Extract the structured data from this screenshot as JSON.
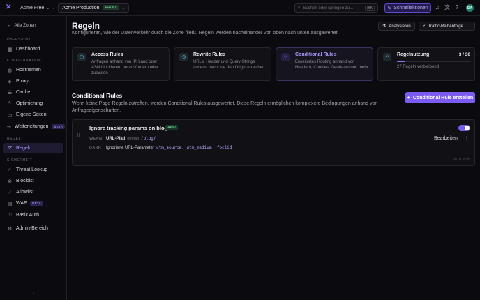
{
  "topbar": {
    "org": "Acme Free",
    "zone": "Acme Production",
    "zone_badge": "PROD",
    "search_placeholder": "Suchen oder springen zu...",
    "search_shortcut": "⌘K",
    "quick_actions": "Schnellaktionen",
    "avatar_initials": "DA"
  },
  "sidebar": {
    "back_label": "Alle Zonen",
    "groups": {
      "overview": "Übersicht",
      "configuration": "Konfiguration",
      "rules": "Regel",
      "security": "Sicherheit"
    },
    "items": {
      "dashboard": "Dashboard",
      "hostnames": "Hostnamen",
      "proxy": "Proxy",
      "cache": "Cache",
      "optimization": "Optimierung",
      "custom_pages": "Eigene Seiten",
      "redirects": "Weiterleitungen",
      "redirects_badge": "BETA",
      "rules": "Regeln",
      "threat_lookup": "Threat Lookup",
      "blocklist": "Blocklist",
      "allowlist": "Allowlist",
      "waf": "WAF",
      "waf_badge": "BETA",
      "basic_auth": "Basic Auth",
      "admin": "Admin-Bereich"
    }
  },
  "main": {
    "title": "Regeln",
    "subtitle": "Konfigurieren, wie der Datenverkehr durch die Zone fließt. Regeln werden nacheinander von oben nach unten ausgewertet.",
    "analyze_button": "Analysieren",
    "traffic_order_button": "Traffic-Reihenfolge",
    "cards": [
      {
        "title": "Access Rules",
        "desc": "Anfragen anhand von IP, Land oder ASN blockieren, herausfordern oder zulassen"
      },
      {
        "title": "Rewrite Rules",
        "desc": "URLs, Header und Query-Strings ändern, bevor sie den Origin erreichen"
      },
      {
        "title": "Conditional Rules",
        "desc": "Erweitertes Routing anhand von Headern, Cookies, Geodaten und mehr"
      }
    ],
    "usage": {
      "title": "Regelnutzung",
      "count": "3 / 30",
      "remaining": "27 Regeln verbleibend",
      "fraction": 0.1
    },
    "section_title": "Conditional Rules",
    "section_subtitle": "Wenn keine Page-Regeln zutreffen, werden Conditional Rules ausgewertet. Diese Regeln ermöglichen komplexere Bedingungen anhand von Anfrageeigenschaften.",
    "create_button": "Conditional Rule erstellen",
    "rule": {
      "title": "Ignore tracking params on blog",
      "status": "Aktiv",
      "when_label": "WENN",
      "condition_field": "URL-Pfad",
      "condition_op": "enthält",
      "condition_value": "/blog/",
      "then_label": "DANN",
      "action": "Ignorierte URL-Parameter",
      "params": "utm_source, utm_medium, fbclid",
      "edit": "Bearbeiten",
      "date": "20.07.2026"
    }
  }
}
